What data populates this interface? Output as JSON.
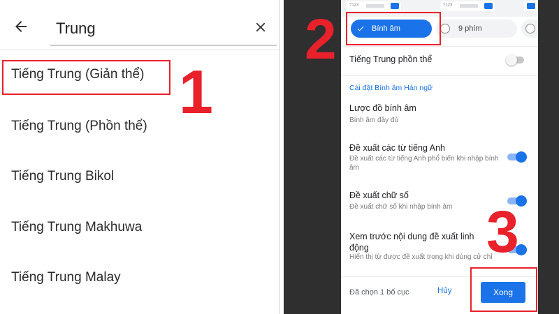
{
  "search": {
    "query": "Trung"
  },
  "languages": [
    "Tiếng Trung (Giản thể)",
    "Tiếng Trung (Phồn thể)",
    "Tiếng Trung Bikol",
    "Tiếng Trung Makhuwa",
    "Tiếng Trung Malay"
  ],
  "steps": [
    "1",
    "2",
    "3"
  ],
  "keyboard_previews": {
    "thumb_text": "?123",
    "bar_text": "拼音"
  },
  "layouts": {
    "selected": "Bính âm",
    "option": "9 phím"
  },
  "settings": {
    "traditional": {
      "title": "Tiếng Trung phồn thể",
      "enabled": false
    },
    "section_title": "Cài đặt Bính âm Hán ngữ",
    "scheme": {
      "title": "Lược đồ bính âm",
      "subtitle": "Bính âm đầy đủ"
    },
    "english_suggest": {
      "title": "Đề xuất các từ tiếng Anh",
      "subtitle": "Đề xuất các từ tiếng Anh phổ biến khi nhập bính âm",
      "enabled": true
    },
    "digit_suggest": {
      "title": "Đề xuất chữ số",
      "subtitle": "Đề xuất chữ số khi nhập bính âm",
      "enabled": true
    },
    "preview_suggest": {
      "title": "Xem trước nội dung đề xuất linh động",
      "subtitle": "Hiển thị từ được đề xuất trong khi dùng cử chỉ",
      "enabled": true
    }
  },
  "footer": {
    "selected_count": "Đã chọn 1 bố cục",
    "cancel": "Hủy",
    "done": "Xong"
  },
  "colors": {
    "accent": "#1a73e8",
    "highlight": "#e8212b"
  }
}
